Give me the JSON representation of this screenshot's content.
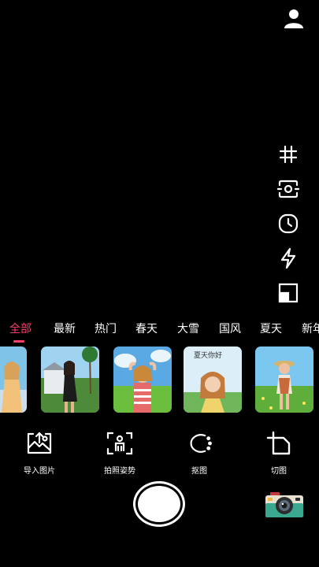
{
  "tabs": [
    {
      "label": "全部",
      "active": true
    },
    {
      "label": "最新"
    },
    {
      "label": "热门"
    },
    {
      "label": "春天"
    },
    {
      "label": "大雪"
    },
    {
      "label": "国风"
    },
    {
      "label": "夏天"
    },
    {
      "label": "新年"
    }
  ],
  "templates": [
    {
      "name": "template-1"
    },
    {
      "name": "template-2"
    },
    {
      "name": "template-3"
    },
    {
      "name": "template-4",
      "caption": "夏天你好"
    },
    {
      "name": "template-5"
    }
  ],
  "actions": {
    "import": "导入图片",
    "pose": "拍照姿势",
    "cutout": "抠图",
    "crop": "切图"
  },
  "icons": {
    "profile": "user-icon",
    "grid": "grid-icon",
    "flip": "flip-camera-icon",
    "timer": "timer-icon",
    "flash": "flash-icon",
    "ratio": "aspect-ratio-icon",
    "camera": "retro-camera-icon"
  },
  "colors": {
    "accent": "#ff3d6b",
    "background": "#000000"
  }
}
